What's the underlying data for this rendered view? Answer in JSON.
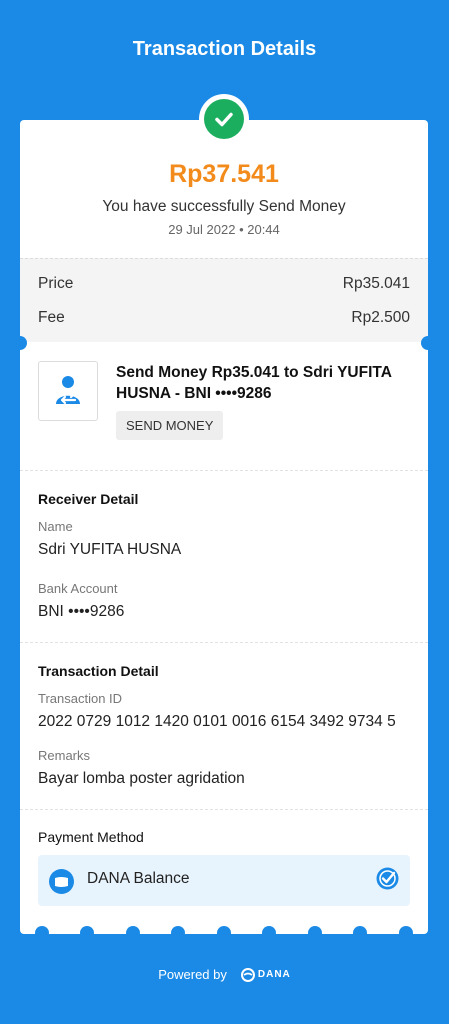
{
  "header": {
    "title": "Transaction Details"
  },
  "summary": {
    "amount": "Rp37.541",
    "message": "You have successfully Send Money",
    "datetime": "29 Jul 2022 • 20:44",
    "status_icon": "check-icon",
    "status_color": "#1cae5f"
  },
  "fees": {
    "price_label": "Price",
    "price_value": "Rp35.041",
    "fee_label": "Fee",
    "fee_value": "Rp2.500"
  },
  "service": {
    "icon": "send-money-icon",
    "title": "Send Money Rp35.041 to Sdri YUFITA HUSNA - BNI ••••9286",
    "chip": "SEND MONEY"
  },
  "receiver": {
    "section_title": "Receiver Detail",
    "name_label": "Name",
    "name_value": "Sdri YUFITA HUSNA",
    "account_label": "Bank Account",
    "account_value": "BNI ••••9286"
  },
  "transaction": {
    "section_title": "Transaction Detail",
    "id_label": "Transaction ID",
    "id_value": "2022 0729 1012 1420 0101 0016 6154 3492 9734 5",
    "remarks_label": "Remarks",
    "remarks_value": "Bayar lomba poster agridation"
  },
  "payment": {
    "section_title": "Payment Method",
    "method": "DANA Balance",
    "method_icon": "wallet-icon",
    "selected_icon": "check-circle-icon"
  },
  "footer": {
    "powered_by": "Powered by",
    "brand": "DANA"
  },
  "colors": {
    "background": "#1b8ae6",
    "amount": "#f28b1b",
    "payment_box": "#e8f4fd"
  }
}
